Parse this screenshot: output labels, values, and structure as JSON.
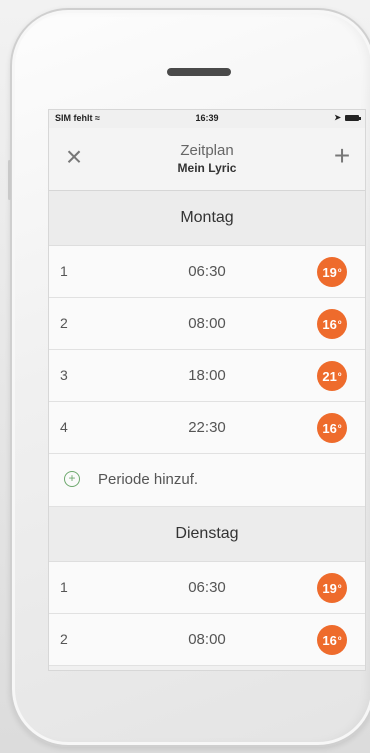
{
  "status": {
    "carrier": "SIM fehlt",
    "time": "16:39"
  },
  "navbar": {
    "title": "Zeitplan",
    "subtitle": "Mein Lyric",
    "close_icon": "close-icon",
    "add_icon": "plus-icon"
  },
  "days": [
    {
      "name": "Montag",
      "periods": [
        {
          "index": "1",
          "time": "06:30",
          "temp": "19"
        },
        {
          "index": "2",
          "time": "08:00",
          "temp": "16"
        },
        {
          "index": "3",
          "time": "18:00",
          "temp": "21"
        },
        {
          "index": "4",
          "time": "22:30",
          "temp": "16"
        }
      ],
      "add_label": "Periode hinzuf."
    },
    {
      "name": "Dienstag",
      "periods": [
        {
          "index": "1",
          "time": "06:30",
          "temp": "19"
        },
        {
          "index": "2",
          "time": "08:00",
          "temp": "16"
        }
      ]
    }
  ],
  "colors": {
    "accent": "#ee6b2c",
    "add_green": "#6da86d"
  }
}
